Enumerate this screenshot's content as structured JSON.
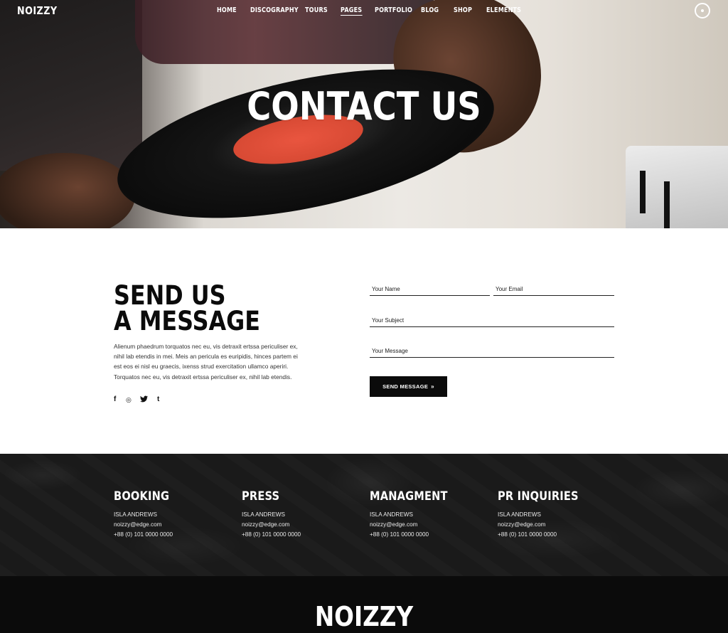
{
  "brand": {
    "logo": "NOIZZY"
  },
  "nav": {
    "items": [
      {
        "label": "HOME",
        "active": false
      },
      {
        "label": "DISCOGRAPHY",
        "active": false
      },
      {
        "label": "TOURS",
        "active": false
      },
      {
        "label": "PAGES",
        "active": true
      },
      {
        "label": "PORTFOLIO",
        "active": false
      },
      {
        "label": "BLOG",
        "active": false
      },
      {
        "label": "SHOP",
        "active": false
      },
      {
        "label": "ELEMENTS",
        "active": false
      }
    ],
    "menu_icon": "circle-dot-menu-icon"
  },
  "hero": {
    "title": "CONTACT US"
  },
  "contact": {
    "title_line1": "SEND US",
    "title_line2": "A MESSAGE",
    "text": "Alienum phaedrum torquatos nec eu, vis detraxit ertssa periculiser ex, nihil lab etendis in mei. Meis an pericula es euripidis, hinces partem ei est eos ei nisl eu graecis, ixenss strud exercitation ullamco aperiri. Torquatos nec eu, vis detraxit ertssa periculiser ex, nihil lab etendis.",
    "socials": [
      {
        "icon": "facebook-icon",
        "glyph": "f"
      },
      {
        "icon": "instagram-icon",
        "glyph": "◎"
      },
      {
        "icon": "twitter-icon",
        "glyph": "🐦"
      },
      {
        "icon": "tumblr-icon",
        "glyph": "t"
      }
    ]
  },
  "form": {
    "name_placeholder": "Your Name",
    "email_placeholder": "Your Email",
    "subject_placeholder": "Your Subject",
    "message_placeholder": "Your Message",
    "submit_label": "SEND MESSAGE",
    "submit_arrow": "»"
  },
  "info": {
    "columns": [
      {
        "title": "BOOKING",
        "name": "ISLA ANDREWS",
        "email": "noizzy@edge.com",
        "phone": "+88 (0) 101 0000 0000"
      },
      {
        "title": "PRESS",
        "name": "ISLA ANDREWS",
        "email": "noizzy@edge.com",
        "phone": "+88 (0) 101 0000 0000"
      },
      {
        "title": "MANAGMENT",
        "name": "ISLA ANDREWS",
        "email": "noizzy@edge.com",
        "phone": "+88 (0) 101 0000 0000"
      },
      {
        "title": "PR INQUIRIES",
        "name": "ISLA ANDREWS",
        "email": "noizzy@edge.com",
        "phone": "+88 (0) 101 0000 0000"
      }
    ]
  },
  "footer": {
    "logo": "NOIZZY"
  },
  "colors": {
    "dark": "#0b0b0b",
    "info_bg": "#1a1a1a",
    "record_label": "#e0503a"
  }
}
